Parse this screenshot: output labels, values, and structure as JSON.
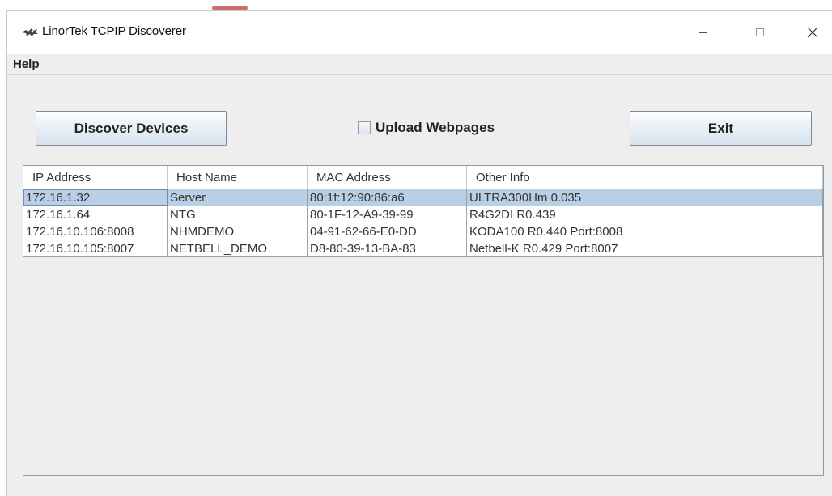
{
  "window": {
    "title": "LinorTek TCPIP Discoverer",
    "controls": [
      "minimize-icon",
      "maximize-icon",
      "close-icon"
    ]
  },
  "menu": {
    "help": "Help"
  },
  "toolbar": {
    "discover_label": "Discover Devices",
    "upload_label": "Upload Webpages",
    "upload_checked": false,
    "exit_label": "Exit"
  },
  "table": {
    "columns": [
      "IP Address",
      "Host Name",
      "MAC Address",
      "Other Info"
    ],
    "rows": [
      [
        "172.16.1.32",
        "Server",
        "80:1f:12:90:86:a6",
        "ULTRA300Hm 0.035"
      ],
      [
        "172.16.1.64",
        "NTG",
        "80-1F-12-A9-39-99",
        "R4G2DI R0.439"
      ],
      [
        "172.16.10.106:8008",
        "NHMDEMO",
        "04-91-62-66-E0-DD",
        "KODA100 R0.440  Port:8008"
      ],
      [
        "172.16.10.105:8007",
        "NETBELL_DEMO",
        "D8-80-39-13-BA-83",
        "Netbell-K R0.429  Port:8007"
      ]
    ],
    "selected_row": 0
  },
  "colors": {
    "selection": "#b8cfe5",
    "window_bg": "#eeeeee",
    "button_gradient_bottom": "#d7e2ee"
  }
}
